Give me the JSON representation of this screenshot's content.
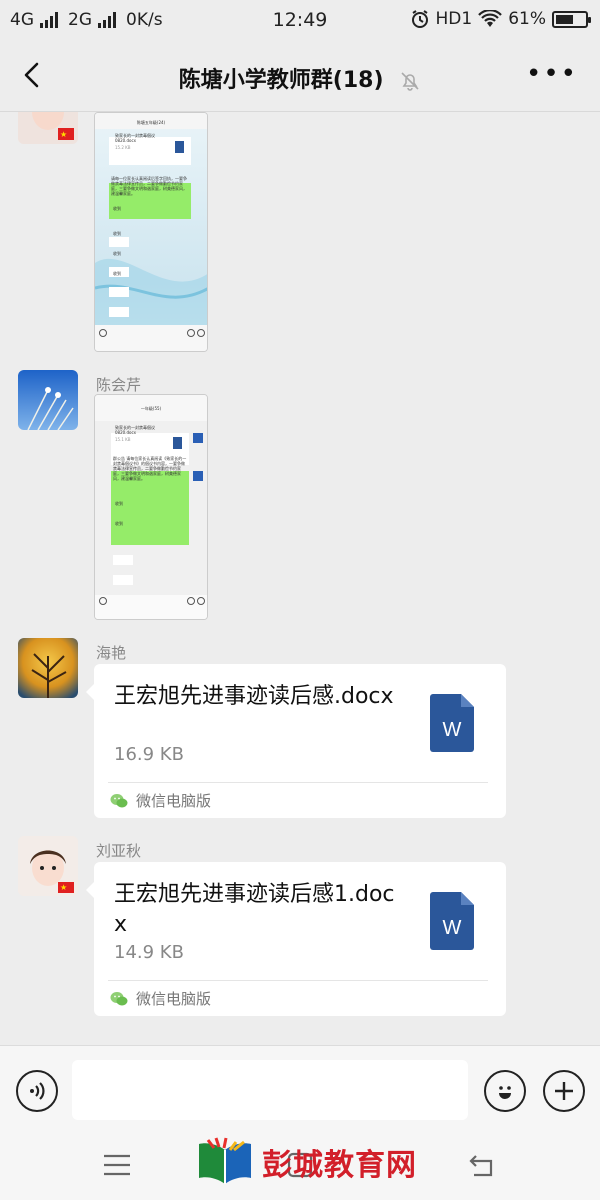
{
  "status_bar": {
    "network1": "4G",
    "network2": "2G",
    "speed": "0K/s",
    "time": "12:49",
    "hd": "HD1",
    "battery": "61%",
    "battery_level": 0.61
  },
  "header": {
    "title": "陈塘小学教师群(18)"
  },
  "messages": [
    {
      "type": "image",
      "sender": "",
      "screenshot": {
        "title": "陈塘五年级(24)",
        "file_name": "致家长的一封禁毒倡议0820.docx",
        "file_size": "15.2 KB",
        "notice": "请每一位家长认真阅读后签字回执，一要争做禁毒法律宣传员，二要争做勤俭节约家庭，三要争做文明和谐家庭，树美德家风，建温馨家庭。",
        "replies": [
          "收到",
          "收到",
          "收到",
          "收到"
        ]
      }
    },
    {
      "type": "image",
      "sender": "陈会芹",
      "screenshot": {
        "title": "一年级(55)",
        "file_name": "致家长的一封禁毒倡议0820.docx",
        "file_size": "15.1 KB",
        "notice": "群公告 请每位家长认真阅读《致家长的一封禁毒倡议书》的倡议书内容，一要争做禁毒法律宣传员，二要争做勤俭节约家庭，三要争做文明和谐家庭，树美德家风，建温馨家庭。",
        "replies": [
          "收到",
          "收到"
        ]
      }
    },
    {
      "type": "file",
      "sender": "海艳",
      "file_name": "王宏旭先进事迹读后感.docx",
      "file_size": "16.9 KB",
      "source": "微信电脑版"
    },
    {
      "type": "file",
      "sender": "刘亚秋",
      "file_name": "王宏旭先进事迹读后感1.docx",
      "file_size": "14.9 KB",
      "source": "微信电脑版"
    }
  ],
  "input": {
    "placeholder": ""
  },
  "watermark": {
    "text": "彭城教育网"
  },
  "colors": {
    "background": "#ededed",
    "bubble": "#ffffff",
    "green_bubble": "#95ec69",
    "word_blue": "#2b579a",
    "watermark_red": "#d21f2a"
  }
}
